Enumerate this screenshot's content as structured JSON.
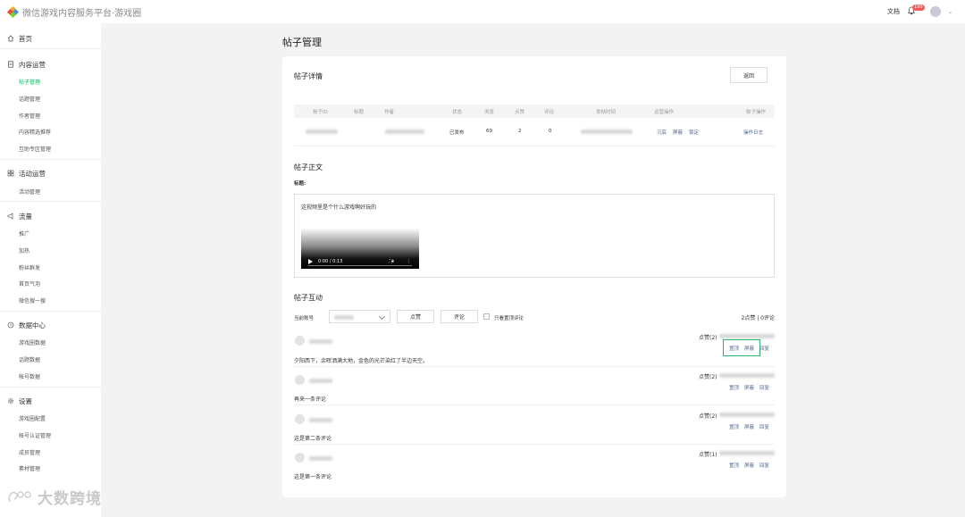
{
  "app": {
    "title": "微信游戏内容服务平台·游戏圈",
    "doc_link": "文档",
    "notification_count": "190",
    "brand_colors": [
      "#f5a623",
      "#4a90e2",
      "#e94e3c",
      "#7ed321"
    ]
  },
  "sidebar": {
    "groups": [
      {
        "label": "首页",
        "icon": "home-icon",
        "items": []
      },
      {
        "label": "内容运营",
        "icon": "document-icon",
        "items": [
          "帖子管理",
          "话题管理",
          "作者管理",
          "内容精选推荐",
          "互助专区管理"
        ]
      },
      {
        "label": "活动运营",
        "icon": "grid-icon",
        "items": [
          "活动管理"
        ]
      },
      {
        "label": "流量",
        "icon": "megaphone-icon",
        "items": [
          "推广",
          "加热",
          "粉丝群发",
          "首页气泡",
          "微信搜一搜"
        ]
      },
      {
        "label": "数据中心",
        "icon": "clock-icon",
        "items": [
          "游戏圈数据",
          "话题数据",
          "帐号数据"
        ]
      },
      {
        "label": "设置",
        "icon": "gear-icon",
        "items": [
          "游戏圈配置",
          "帐号认证管理",
          "成员管理",
          "素材管理"
        ]
      }
    ],
    "active_item": "帖子管理",
    "active_color": "#07c160",
    "watermark": "大数跨境"
  },
  "page": {
    "title": "帖子管理"
  },
  "detail": {
    "title": "帖子详情",
    "back_label": "返回",
    "columns": [
      "帖子ID",
      "标题",
      "作者",
      "状态",
      "浏览",
      "点赞",
      "评论",
      "发帖时间",
      "运营操作",
      "帖子操作"
    ],
    "row": {
      "status": "已发布",
      "views": "69",
      "likes": "2",
      "comments": "0",
      "ops": [
        "沉底",
        "屏蔽",
        "锁定"
      ],
      "post_op": "操作日志"
    }
  },
  "body": {
    "title": "帖子正文",
    "subtitle_label": "标题:",
    "text": "这视频里是个什么游戏啊好玩的",
    "video_time": "0:00 / 0:13"
  },
  "interaction": {
    "title": "帖子互动",
    "account_label": "当前账号",
    "like_button": "点赞",
    "comment_button": "评论",
    "only_top_label": "只看置顶评论",
    "summary": "2点赞 | 0评论",
    "comments": [
      {
        "text": "夕阳西下，余晖洒满大地，金色的光芒染红了半边天空。",
        "likes": "点赞(2)",
        "actions": [
          "置顶",
          "屏蔽",
          "回复"
        ]
      },
      {
        "text": "再来一条评论",
        "likes": "点赞(2)",
        "actions": [
          "置顶",
          "屏蔽",
          "回复"
        ]
      },
      {
        "text": "这是第二条评论",
        "likes": "点赞(2)",
        "actions": [
          "置顶",
          "屏蔽",
          "回复"
        ]
      },
      {
        "text": "这是第一条评论",
        "likes": "点赞(1)",
        "actions": [
          "置顶",
          "屏蔽",
          "回复"
        ]
      }
    ]
  }
}
